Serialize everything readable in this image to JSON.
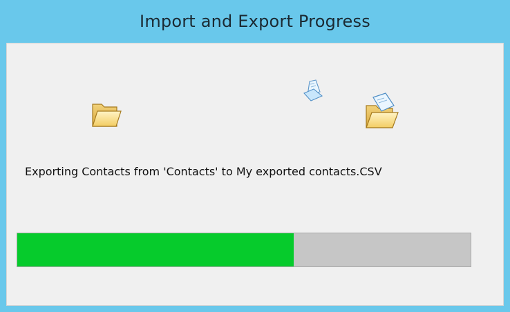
{
  "window": {
    "title": "Import and Export Progress"
  },
  "animation": {
    "source_icon": "folder-icon",
    "moving_icon": "document-icon",
    "target_icon": "open-folder-document-icon"
  },
  "status": {
    "message": "Exporting Contacts from 'Contacts' to My exported contacts.CSV"
  },
  "progress": {
    "value": 0.61,
    "fill_color": "#06cb2c",
    "track_color": "#c6c6c6"
  },
  "colors": {
    "frame": "#69c8eb",
    "client": "#f0f0f0"
  }
}
